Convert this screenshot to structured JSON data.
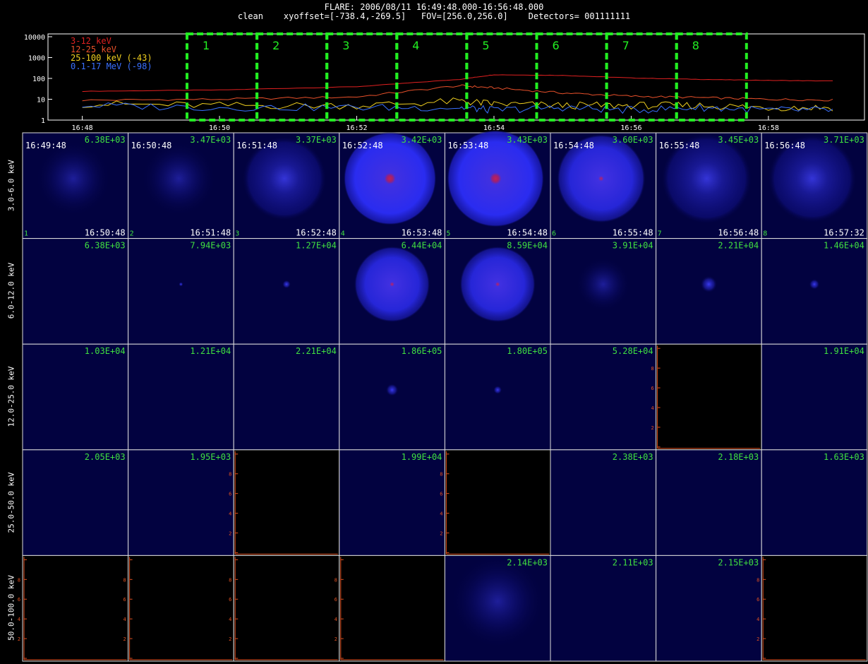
{
  "header": {
    "line1": "FLARE: 2006/08/11 16:49:48.000-16:56:48.000",
    "line2": "clean    xyoffset=[-738.4,-269.5]   FOV=[256.0,256.0]    Detectors= 001111111"
  },
  "chart_data": [
    {
      "type": "line",
      "scale": "log",
      "ylim": [
        1,
        10000
      ],
      "y_ticks": [
        "10000",
        "1000",
        "100",
        "10",
        "1"
      ],
      "x_ticks": [
        "16:48",
        "16:50",
        "16:52",
        "16:54",
        "16:56",
        "16:58"
      ],
      "legend": [
        {
          "label": "3-12 keV",
          "color": "#e02020"
        },
        {
          "label": "12-25 keV",
          "color": "#e8502a"
        },
        {
          "label": "25-100 keV (-43)",
          "color": "#f0d020"
        },
        {
          "label": "0.1-17 MeV (-98)",
          "color": "#3a70ff"
        }
      ],
      "intervals": [
        "1",
        "2",
        "3",
        "4",
        "5",
        "6",
        "7",
        "8"
      ],
      "series": [
        {
          "name": "3-12 keV",
          "color": "#e02020",
          "x": [
            "16:48",
            "16:50",
            "16:52",
            "16:53:30",
            "16:54",
            "16:55",
            "16:56",
            "16:57",
            "16:58",
            "16:59"
          ],
          "values": [
            24,
            28,
            40,
            90,
            150,
            140,
            105,
            90,
            80,
            75
          ]
        },
        {
          "name": "12-25 keV",
          "color": "#e8502a",
          "x": [
            "16:48",
            "16:50",
            "16:52",
            "16:53:30",
            "16:54",
            "16:55",
            "16:56",
            "16:57",
            "16:58",
            "16:59"
          ],
          "values": [
            9,
            10,
            13,
            45,
            35,
            20,
            14,
            12,
            10,
            9
          ]
        },
        {
          "name": "25-100 keV (-43)",
          "color": "#f0d020",
          "x": [
            "16:48",
            "16:50",
            "16:52",
            "16:53:30",
            "16:54",
            "16:55",
            "16:56",
            "16:57",
            "16:58",
            "16:59"
          ],
          "values": [
            6,
            5,
            5,
            8,
            6,
            5,
            5,
            5,
            4,
            4
          ]
        },
        {
          "name": "0.1-17 MeV (-98)",
          "color": "#3a70ff",
          "x": [
            "16:48",
            "16:50",
            "16:52",
            "16:53:30",
            "16:54",
            "16:55",
            "16:56",
            "16:57",
            "16:58",
            "16:59"
          ],
          "values": [
            5,
            4,
            4,
            4,
            3,
            4,
            3,
            4,
            3,
            3
          ]
        }
      ]
    },
    {
      "type": "heatmap",
      "rows": [
        "3.0-6.0 keV",
        "6.0-12.0 keV",
        "12.0-25.0 keV",
        "25.0-50.0 keV",
        "50.0-100.0 keV"
      ],
      "columns": [
        "1",
        "2",
        "3",
        "4",
        "5",
        "6",
        "7",
        "8"
      ],
      "start_times": [
        "16:49:48",
        "16:50:48",
        "16:51:48",
        "16:52:48",
        "16:53:48",
        "16:54:48",
        "16:55:48",
        "16:56:48"
      ],
      "end_times": [
        "16:50:48",
        "16:51:48",
        "16:52:48",
        "16:53:48",
        "16:54:48",
        "16:55:48",
        "16:56:48",
        "16:57:32"
      ],
      "max_values": [
        [
          "6.38E+03",
          "3.47E+03",
          "3.37E+03",
          "3.42E+03",
          "3.43E+03",
          "3.60E+03",
          "3.45E+03",
          "3.71E+03"
        ],
        [
          "6.38E+03",
          "7.94E+03",
          "1.27E+04",
          "6.44E+04",
          "8.59E+04",
          "3.91E+04",
          "2.21E+04",
          "1.46E+04"
        ],
        [
          "1.03E+04",
          "1.21E+04",
          "2.21E+04",
          "1.86E+05",
          "1.80E+05",
          "5.28E+04",
          "",
          "1.91E+04"
        ],
        [
          "2.05E+03",
          "1.95E+03",
          "",
          "1.99E+04",
          "",
          "2.38E+03",
          "2.18E+03",
          "1.63E+03"
        ],
        [
          "",
          "",
          "",
          "",
          "2.14E+03",
          "2.11E+03",
          "2.15E+03",
          ""
        ]
      ],
      "empty_panels": [
        [
          2,
          6
        ],
        [
          3,
          2
        ],
        [
          3,
          4
        ],
        [
          4,
          0
        ],
        [
          4,
          1
        ],
        [
          4,
          2
        ],
        [
          4,
          3
        ],
        [
          4,
          7
        ]
      ],
      "axis_ticks": [
        "0",
        "2",
        "4",
        "6",
        "8",
        "10"
      ],
      "colors": {
        "background": "#020240",
        "value_label": "#40e040",
        "empty_axis": "#e05020",
        "interval_box": "#22ee22"
      }
    }
  ]
}
